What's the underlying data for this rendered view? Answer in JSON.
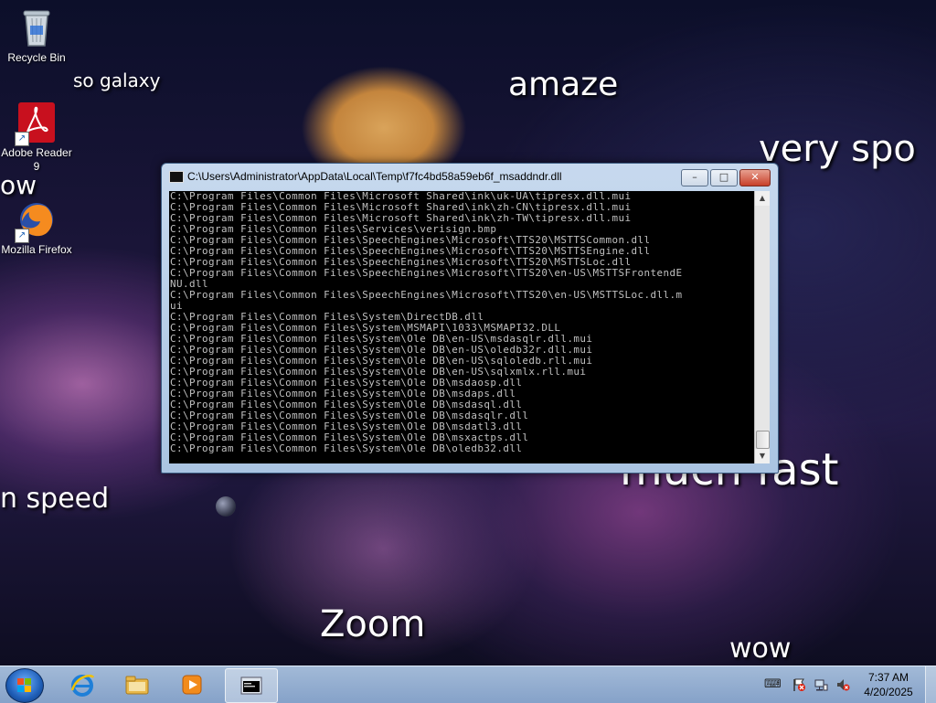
{
  "desktop": {
    "icons": [
      {
        "label": "Recycle Bin",
        "icon": "recycle-bin-icon"
      },
      {
        "label": "Adobe Reader 9",
        "icon": "adobe-reader-icon"
      },
      {
        "label": "Mozilla Firefox",
        "icon": "firefox-icon"
      }
    ],
    "meme_words": [
      "so galaxy",
      "amaze",
      "very spo",
      "ow",
      "n speed",
      "much fast",
      "Zoom",
      "wow"
    ]
  },
  "console_window": {
    "title": "C:\\Users\\Administrator\\AppData\\Local\\Temp\\f7fc4bd58a59eb6f_msaddndr.dll",
    "minimize_symbol": "–",
    "maximize_symbol": "□",
    "close_symbol": "✕",
    "output": "C:\\Program Files\\Common Files\\Microsoft Shared\\ink\\uk-UA\\tipresx.dll.mui\nC:\\Program Files\\Common Files\\Microsoft Shared\\ink\\zh-CN\\tipresx.dll.mui\nC:\\Program Files\\Common Files\\Microsoft Shared\\ink\\zh-TW\\tipresx.dll.mui\nC:\\Program Files\\Common Files\\Services\\verisign.bmp\nC:\\Program Files\\Common Files\\SpeechEngines\\Microsoft\\TTS20\\MSTTSCommon.dll\nC:\\Program Files\\Common Files\\SpeechEngines\\Microsoft\\TTS20\\MSTTSEngine.dll\nC:\\Program Files\\Common Files\\SpeechEngines\\Microsoft\\TTS20\\MSTTSLoc.dll\nC:\\Program Files\\Common Files\\SpeechEngines\\Microsoft\\TTS20\\en-US\\MSTTSFrontendE\nNU.dll\nC:\\Program Files\\Common Files\\SpeechEngines\\Microsoft\\TTS20\\en-US\\MSTTSLoc.dll.m\nui\nC:\\Program Files\\Common Files\\System\\DirectDB.dll\nC:\\Program Files\\Common Files\\System\\MSMAPI\\1033\\MSMAPI32.DLL\nC:\\Program Files\\Common Files\\System\\Ole DB\\en-US\\msdasqlr.dll.mui\nC:\\Program Files\\Common Files\\System\\Ole DB\\en-US\\oledb32r.dll.mui\nC:\\Program Files\\Common Files\\System\\Ole DB\\en-US\\sqloledb.rll.mui\nC:\\Program Files\\Common Files\\System\\Ole DB\\en-US\\sqlxmlx.rll.mui\nC:\\Program Files\\Common Files\\System\\Ole DB\\msdaosp.dll\nC:\\Program Files\\Common Files\\System\\Ole DB\\msdaps.dll\nC:\\Program Files\\Common Files\\System\\Ole DB\\msdasql.dll\nC:\\Program Files\\Common Files\\System\\Ole DB\\msdasqlr.dll\nC:\\Program Files\\Common Files\\System\\Ole DB\\msdatl3.dll\nC:\\Program Files\\Common Files\\System\\Ole DB\\msxactps.dll\nC:\\Program Files\\Common Files\\System\\Ole DB\\oledb32.dll",
    "scrollbar_up": "▲",
    "scrollbar_down": "▼"
  },
  "taskbar": {
    "pinned": [
      {
        "icon": "internet-explorer-icon"
      },
      {
        "icon": "file-explorer-icon"
      },
      {
        "icon": "media-player-icon"
      },
      {
        "icon": "console-window-icon",
        "active": true
      }
    ],
    "tray_icons": [
      "keyboard-icon",
      "action-center-flag-icon",
      "network-icon",
      "volume-muted-icon"
    ],
    "clock": {
      "time": "7:37 AM",
      "date": "4/20/2025"
    }
  }
}
